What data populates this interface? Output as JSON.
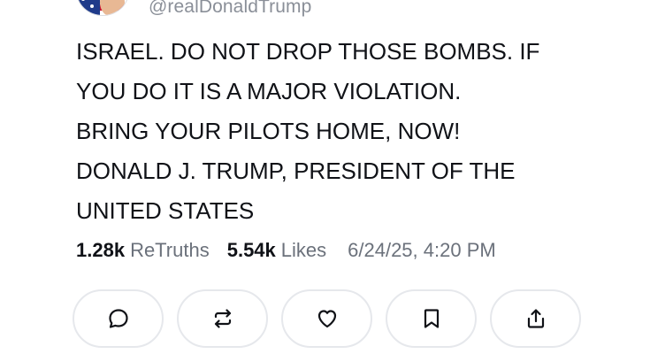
{
  "post": {
    "handle": "@realDonaldTrump",
    "lines": [
      "ISRAEL. DO NOT DROP THOSE BOMBS. IF",
      "YOU DO IT IS A MAJOR VIOLATION.",
      "BRING YOUR PILOTS HOME, NOW!",
      "DONALD J. TRUMP, PRESIDENT OF THE",
      "UNITED STATES"
    ],
    "retruths_count": "1.28k",
    "retruths_label": "ReTruths",
    "likes_count": "5.54k",
    "likes_label": "Likes",
    "timestamp": "6/24/25, 4:20 PM"
  },
  "actions": [
    {
      "icon": "reply-icon"
    },
    {
      "icon": "retruth-icon"
    },
    {
      "icon": "heart-icon"
    },
    {
      "icon": "bookmark-icon"
    },
    {
      "icon": "share-icon"
    }
  ],
  "colors": {
    "text": "#101217",
    "muted": "#6b717b",
    "border": "#e6e8ec"
  }
}
